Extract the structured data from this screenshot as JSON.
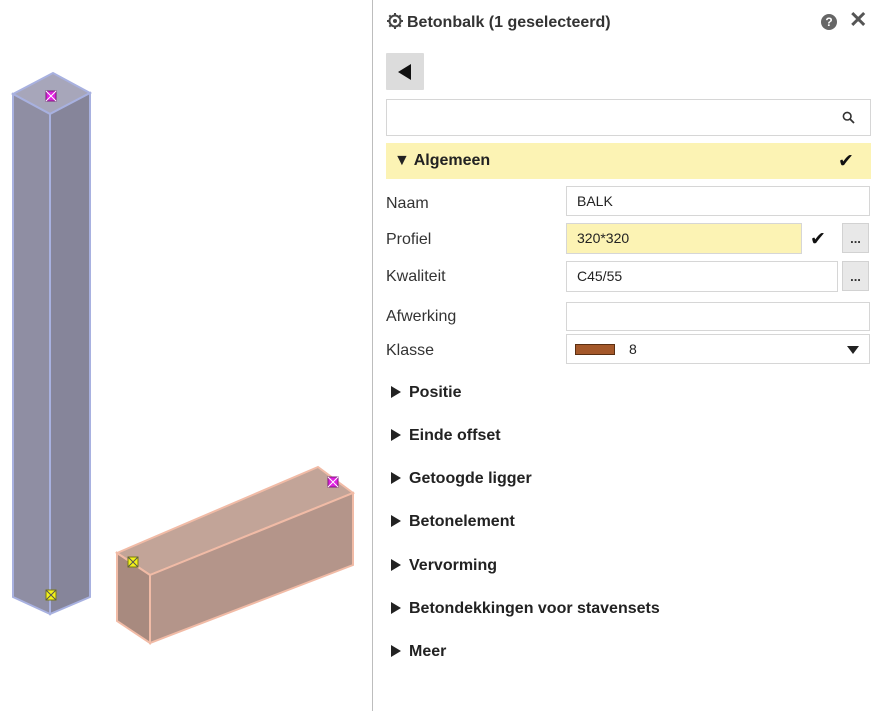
{
  "panel": {
    "title": "Betonbalk (1 geselecteerd)",
    "help_icon": "?",
    "close_icon": "✕",
    "search": {
      "value": "",
      "placeholder": ""
    }
  },
  "sections": {
    "algemeen": {
      "label": "Algemeen",
      "expanded": true,
      "properties": {
        "naam": {
          "label": "Naam",
          "value": "BALK"
        },
        "profiel": {
          "label": "Profiel",
          "value": "320*320"
        },
        "kwaliteit": {
          "label": "Kwaliteit",
          "value": "C45/55"
        },
        "afwerking": {
          "label": "Afwerking",
          "value": ""
        },
        "klasse": {
          "label": "Klasse",
          "value": "8",
          "swatch_color": "#a4582a"
        }
      },
      "more_button": "..."
    },
    "collapsed": [
      {
        "label": "Positie"
      },
      {
        "label": "Einde offset"
      },
      {
        "label": "Getoogde ligger"
      },
      {
        "label": "Betonelement"
      },
      {
        "label": "Vervorming"
      },
      {
        "label": "Betondekkingen voor stavensets"
      },
      {
        "label": "Meer"
      }
    ]
  },
  "colors": {
    "column_fill": "#8f8ea3",
    "column_edge": "#a8b1e0",
    "beam_fill": "#b4958a",
    "beam_edge": "#f1bba6",
    "handle_magenta": "#e020e0",
    "handle_yellow": "#f2f21a",
    "highlight": "#fcf3b4"
  }
}
